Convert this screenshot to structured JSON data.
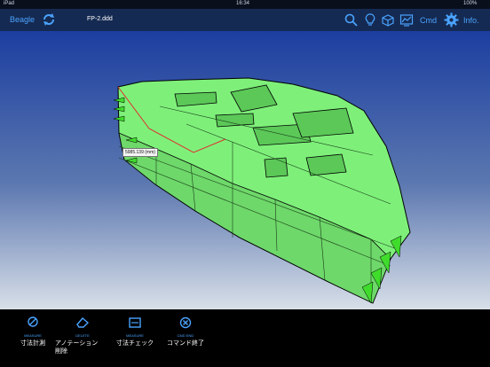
{
  "status": {
    "carrier": "iPad",
    "time": "16:34",
    "battery": "100%"
  },
  "nav": {
    "brand": "Beagle",
    "filename": "FP-2.ddd",
    "cmd": "Cmd",
    "info": "Info."
  },
  "viewport": {
    "measurement": "5985.139 (mm)",
    "model_color": "#7ef07a",
    "background_top": "#1c3ea0"
  },
  "toolbar": {
    "items": [
      {
        "icon_text": "MEASURE",
        "label": "寸法計測"
      },
      {
        "icon_text": "DELETE",
        "label": "アノテーション\n削除"
      },
      {
        "icon_text": "MEASURE",
        "label": "寸法チェック"
      },
      {
        "icon_text": "CMD END",
        "label": "コマンド終了"
      }
    ]
  },
  "colors": {
    "accent": "#4aa3ff",
    "navbar": "#152a52"
  }
}
